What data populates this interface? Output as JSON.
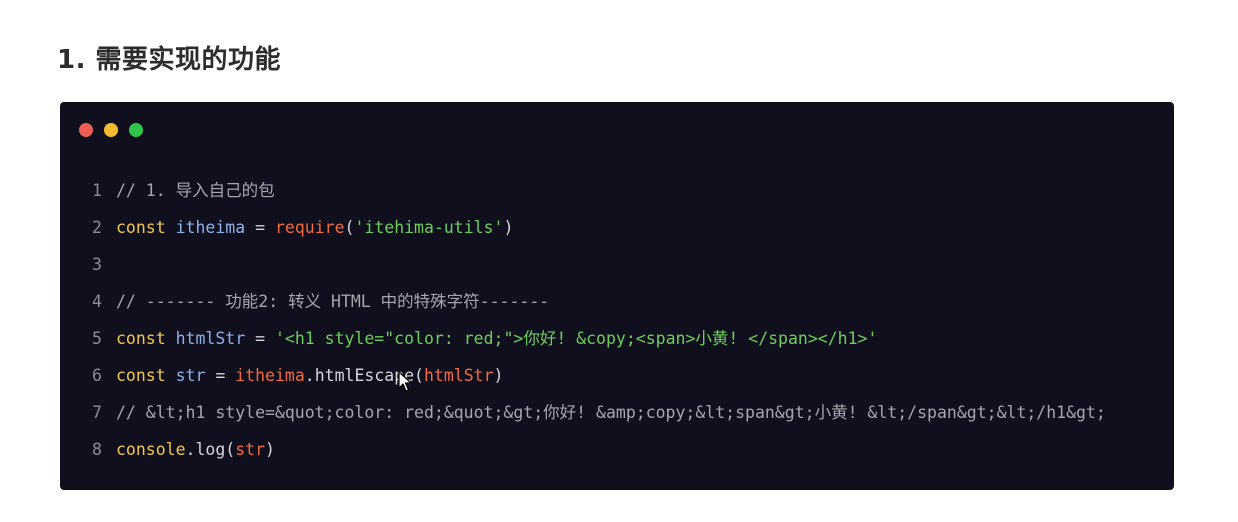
{
  "heading": "1. 需要实现的功能",
  "window": {
    "dots": [
      {
        "name": "close-dot",
        "color": "#ed5f55"
      },
      {
        "name": "minimize-dot",
        "color": "#f4bb2f"
      },
      {
        "name": "maximize-dot",
        "color": "#32c648"
      }
    ]
  },
  "colors": {
    "background": "#0f0f1e",
    "comment": "#a6a6ae",
    "keyword": "#f3c84b",
    "identifier": "#8fb2e8",
    "function": "#f26a3d",
    "string": "#6fce5a"
  },
  "code_lines": [
    {
      "number": "1",
      "tokens": [
        {
          "text": "// 1. 导入自己的包",
          "kind": "comment"
        }
      ]
    },
    {
      "number": "2",
      "tokens": [
        {
          "text": "const",
          "kind": "keyword"
        },
        {
          "text": " ",
          "kind": "plain"
        },
        {
          "text": "itheima",
          "kind": "ident"
        },
        {
          "text": " = ",
          "kind": "op"
        },
        {
          "text": "require",
          "kind": "func"
        },
        {
          "text": "(",
          "kind": "plain"
        },
        {
          "text": "'itehima-utils'",
          "kind": "string"
        },
        {
          "text": ")",
          "kind": "plain"
        }
      ]
    },
    {
      "number": "3",
      "tokens": []
    },
    {
      "number": "4",
      "tokens": [
        {
          "text": "// ------- 功能2: 转义 HTML 中的特殊字符-------",
          "kind": "comment"
        }
      ]
    },
    {
      "number": "5",
      "tokens": [
        {
          "text": "const",
          "kind": "keyword"
        },
        {
          "text": " ",
          "kind": "plain"
        },
        {
          "text": "htmlStr",
          "kind": "ident"
        },
        {
          "text": " = ",
          "kind": "op"
        },
        {
          "text": "'<h1 style=\"color: red;\">你好! &copy;<span>小黄! </span></h1>'",
          "kind": "string"
        }
      ]
    },
    {
      "number": "6",
      "tokens": [
        {
          "text": "const",
          "kind": "keyword"
        },
        {
          "text": " ",
          "kind": "plain"
        },
        {
          "text": "str",
          "kind": "ident"
        },
        {
          "text": " = ",
          "kind": "op"
        },
        {
          "text": "itheima",
          "kind": "func"
        },
        {
          "text": ".htmlEscape(",
          "kind": "plain"
        },
        {
          "text": "htmlStr",
          "kind": "func"
        },
        {
          "text": ")",
          "kind": "plain"
        }
      ]
    },
    {
      "number": "7",
      "tokens": [
        {
          "text": "// &lt;h1 style=&quot;color: red;&quot;&gt;你好! &amp;copy;&lt;span&gt;小黄! &lt;/span&gt;&lt;/h1&gt;",
          "kind": "comment"
        }
      ]
    },
    {
      "number": "8",
      "tokens": [
        {
          "text": "console",
          "kind": "keyword"
        },
        {
          "text": ".log(",
          "kind": "plain"
        },
        {
          "text": "str",
          "kind": "func"
        },
        {
          "text": ")",
          "kind": "plain"
        }
      ]
    }
  ]
}
